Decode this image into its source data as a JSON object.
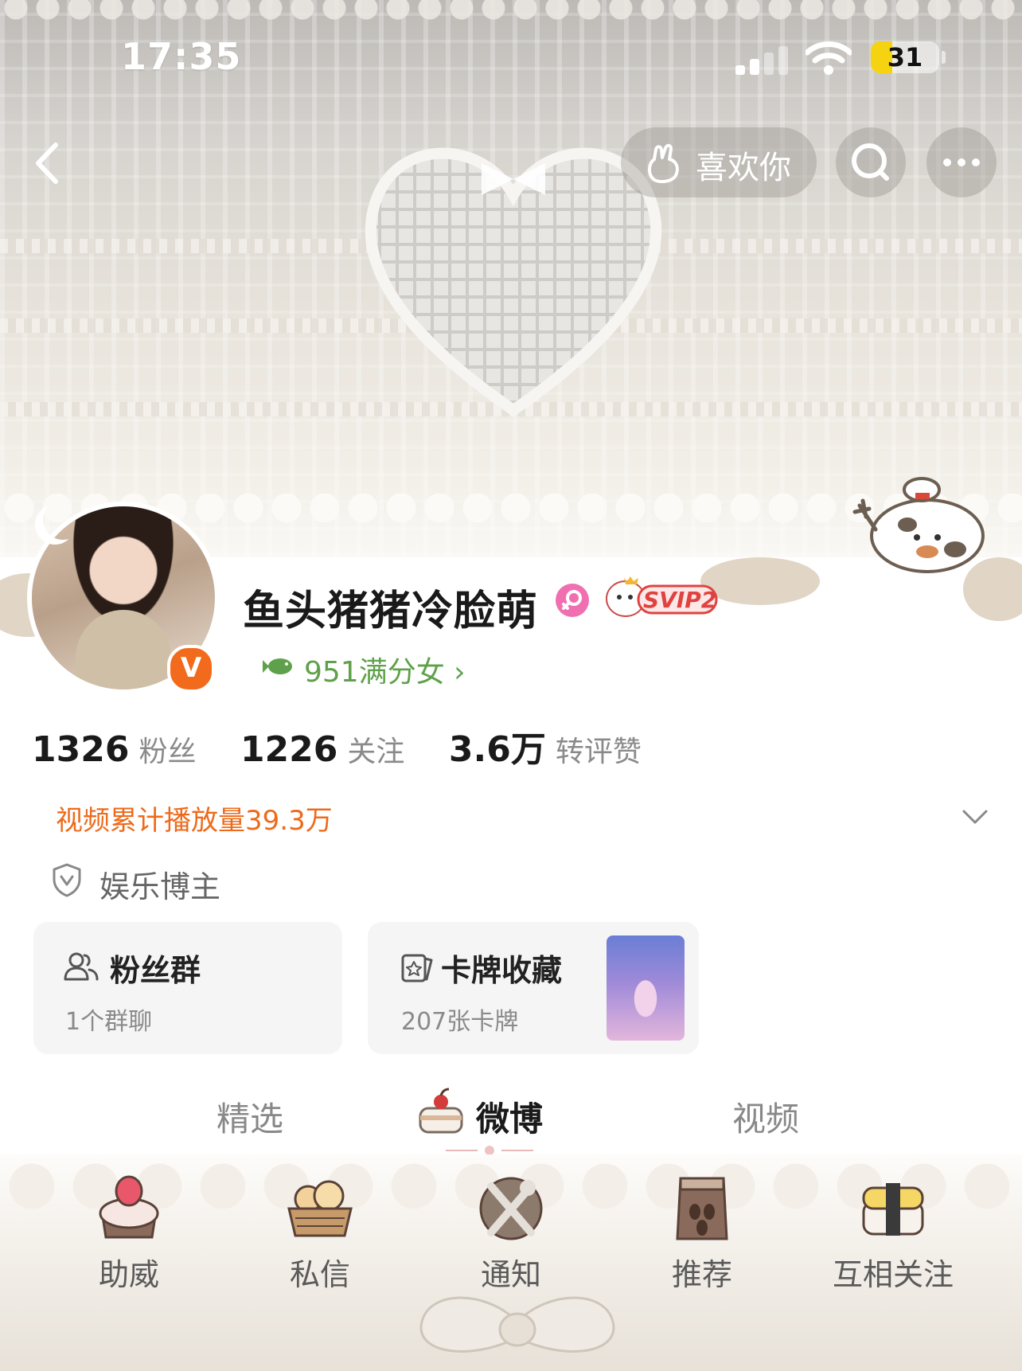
{
  "status_bar": {
    "time": "17:35",
    "battery": "31",
    "battery_level": 0.31
  },
  "header": {
    "like_label": "喜欢你"
  },
  "profile": {
    "username": "鱼头猪猪冷脸萌",
    "vip_badge": "SVIP2",
    "fan_title": "951满分女 ›",
    "verified_mark": "V"
  },
  "stats": [
    {
      "value": "1326",
      "label": "粉丝"
    },
    {
      "value": "1226",
      "label": "关注"
    },
    {
      "value": "3.6万",
      "label": "转评赞"
    }
  ],
  "video_count": "视频累计播放量39.3万",
  "role": "娱乐博主",
  "cards": [
    {
      "title": "粉丝群",
      "subtitle": "1个群聊"
    },
    {
      "title": "卡牌收藏",
      "subtitle": "207张卡牌"
    }
  ],
  "tabs": [
    {
      "label": "精选"
    },
    {
      "label": "微博",
      "active": true
    },
    {
      "label": "视频"
    }
  ],
  "bottom_nav": [
    {
      "label": "助威",
      "icon": "cake-icon"
    },
    {
      "label": "私信",
      "icon": "bread-basket-icon"
    },
    {
      "label": "通知",
      "icon": "utensils-icon"
    },
    {
      "label": "推荐",
      "icon": "coffee-bag-icon"
    },
    {
      "label": "互相关注",
      "icon": "sushi-icon"
    }
  ],
  "colors": {
    "accent_orange": "#ee6a1b",
    "fan_green": "#5fa14a",
    "verified_orange": "#f26a1b"
  }
}
